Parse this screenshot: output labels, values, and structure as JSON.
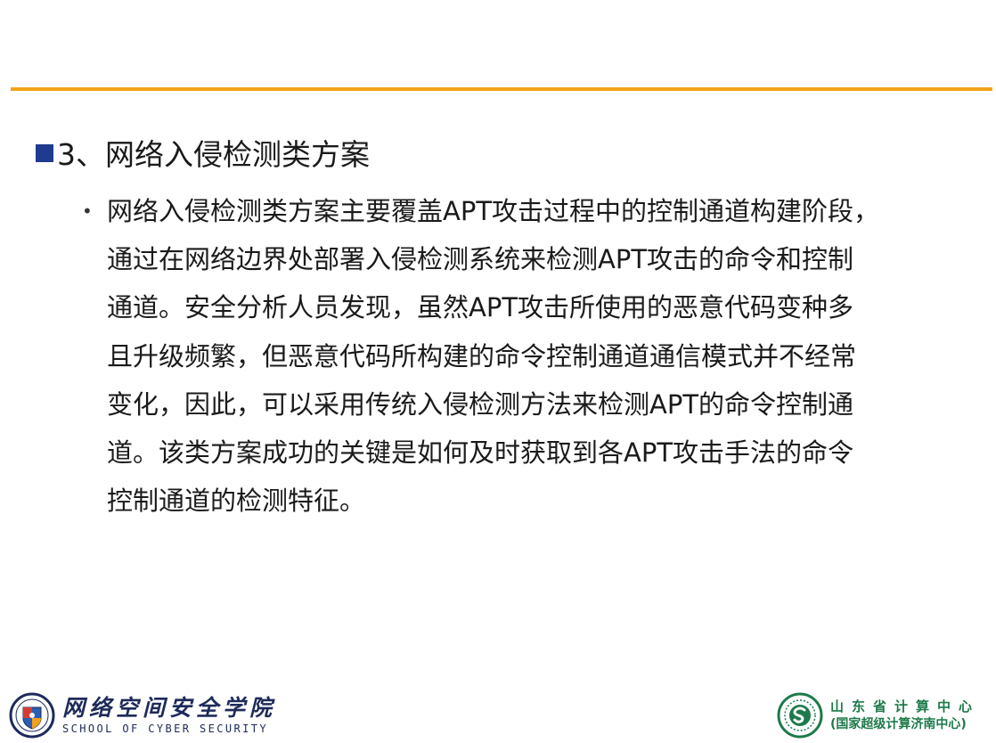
{
  "slide": {
    "heading": "3、网络入侵检测类方案",
    "bullet_glyph": "•",
    "paragraph_lines": [
      "网络入侵检测类方案主要覆盖APT攻击过程中的控制通道构建阶段，",
      "通过在网络边界处部署入侵检测系统来检测APT攻击的命令和控制",
      "通道。安全分析人员发现，虽然APT攻击所使用的恶意代码变种多",
      "且升级频繁，但恶意代码所构建的命令控制通道通信模式并不经常",
      "变化，因此，可以采用传统入侵检测方法来检测APT的命令控制通",
      "道。该类方案成功的关键是如何及时获取到各APT攻击手法的命令",
      "控制通道的检测特征。"
    ]
  },
  "footer": {
    "school_name_cn": "网络空间安全学院",
    "school_name_en": "SCHOOL OF CYBER SECURITY",
    "center_name_cn": "山东省计算中心",
    "center_subtitle": "(国家超级计算济南中心)"
  },
  "colors": {
    "accent_rule": "#f2a218",
    "heading_square": "#1f3b8f",
    "school_blue": "#1e2a5a",
    "center_green": "#1d7a4a"
  },
  "icons": {
    "school_logo": "university-shield-emblem",
    "center_logo": "computing-center-seal-emblem"
  }
}
